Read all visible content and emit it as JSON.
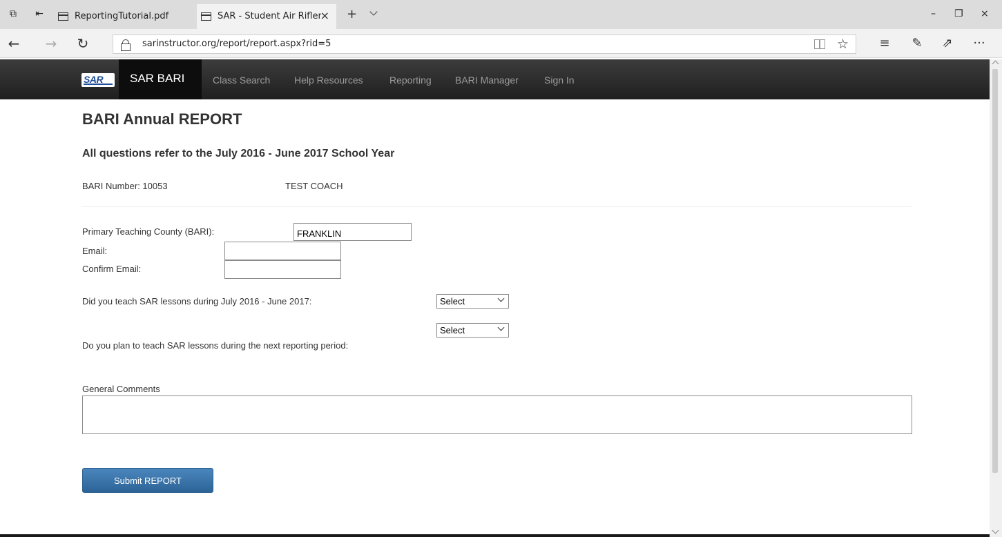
{
  "browser": {
    "tabs": [
      {
        "title": "ReportingTutorial.pdf",
        "active": false
      },
      {
        "title": "SAR - Student Air Riflery",
        "active": true
      }
    ],
    "tab_close_glyph": "×",
    "new_tab_glyph": "+",
    "window_controls": {
      "minimize": "–",
      "restore": "❐",
      "close": "×"
    },
    "nav": {
      "back": "←",
      "forward": "→",
      "refresh": "↻"
    },
    "address": "sarinstructor.org/report/report.aspx?rid=5",
    "favorite_glyph": "☆",
    "tools": {
      "hub": "≡",
      "notes": "✎",
      "share": "⇗",
      "more": "···"
    }
  },
  "site_nav": {
    "brand_logo_text": "SAR",
    "brand_title": "SAR BARI",
    "links": [
      "Class Search",
      "Help Resources",
      "Reporting",
      "BARI Manager",
      "Sign In"
    ]
  },
  "page": {
    "title": "BARI Annual REPORT",
    "year_heading": "All questions refer to the July 2016 - June 2017 School Year",
    "bari_number_label": "BARI Number: 10053",
    "coach_name": "TEST COACH",
    "form": {
      "county_label": "Primary Teaching County (BARI):",
      "county_value": "FRANKLIN",
      "email_label": "Email:",
      "email_value": "",
      "confirm_email_label": "Confirm Email:",
      "confirm_email_value": "",
      "q_taught_label": "Did you teach SAR lessons during July 2016 - June 2017:",
      "q_taught_value": "Select",
      "q_plan_label": "Do you plan to teach SAR lessons during the next reporting period:",
      "q_plan_value": "Select",
      "comments_label": "General Comments",
      "comments_value": "",
      "submit_label": "Submit REPORT"
    }
  },
  "colors": {
    "navbar": "#222222",
    "button": "#337ab7",
    "text": "#333333"
  }
}
